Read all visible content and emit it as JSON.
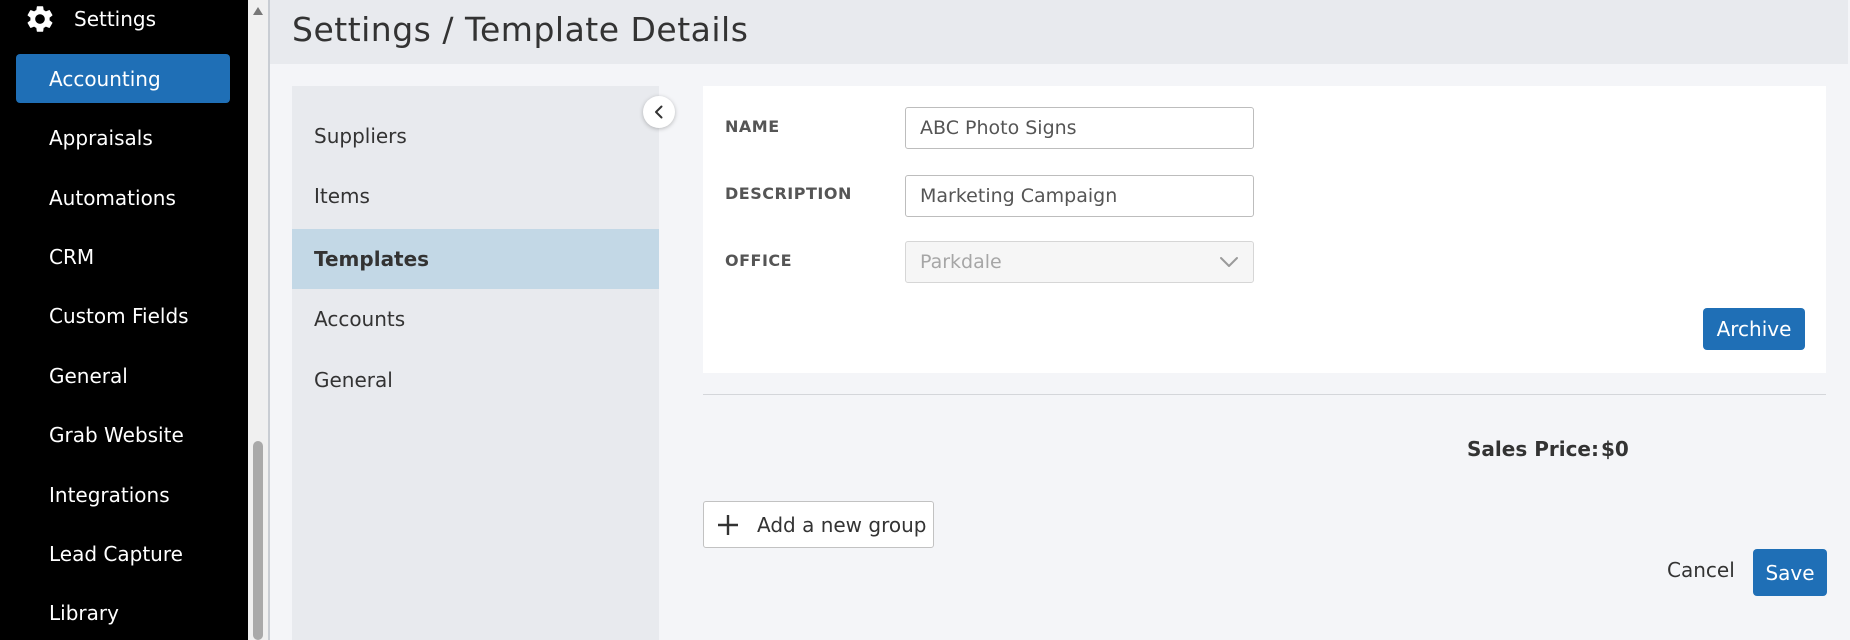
{
  "sidebar": {
    "header_label": "Settings",
    "header_icon": "gear-icon",
    "active_color": "#1f6fb6",
    "items": [
      {
        "label": "Accounting",
        "active": true
      },
      {
        "label": "Appraisals"
      },
      {
        "label": "Automations"
      },
      {
        "label": "CRM"
      },
      {
        "label": "Custom Fields"
      },
      {
        "label": "General"
      },
      {
        "label": "Grab Website"
      },
      {
        "label": "Integrations"
      },
      {
        "label": "Lead Capture"
      },
      {
        "label": "Library"
      }
    ]
  },
  "header": {
    "title": "Settings / Template Details"
  },
  "subnav": {
    "items": [
      {
        "label": "Suppliers"
      },
      {
        "label": "Items"
      },
      {
        "label": "Templates",
        "active": true
      },
      {
        "label": "Accounts"
      },
      {
        "label": "General"
      }
    ],
    "collapse_icon": "chevron-left-icon"
  },
  "form": {
    "name_label": "NAME",
    "name_value": "ABC Photo Signs",
    "description_label": "DESCRIPTION",
    "description_value": "Marketing Campaign",
    "office_label": "OFFICE",
    "office_value": "Parkdale",
    "archive_label": "Archive"
  },
  "summary": {
    "sales_price_label": "Sales Price:",
    "sales_price_value": "$0"
  },
  "actions": {
    "add_group_label": "Add a new group",
    "cancel_label": "Cancel",
    "save_label": "Save"
  }
}
